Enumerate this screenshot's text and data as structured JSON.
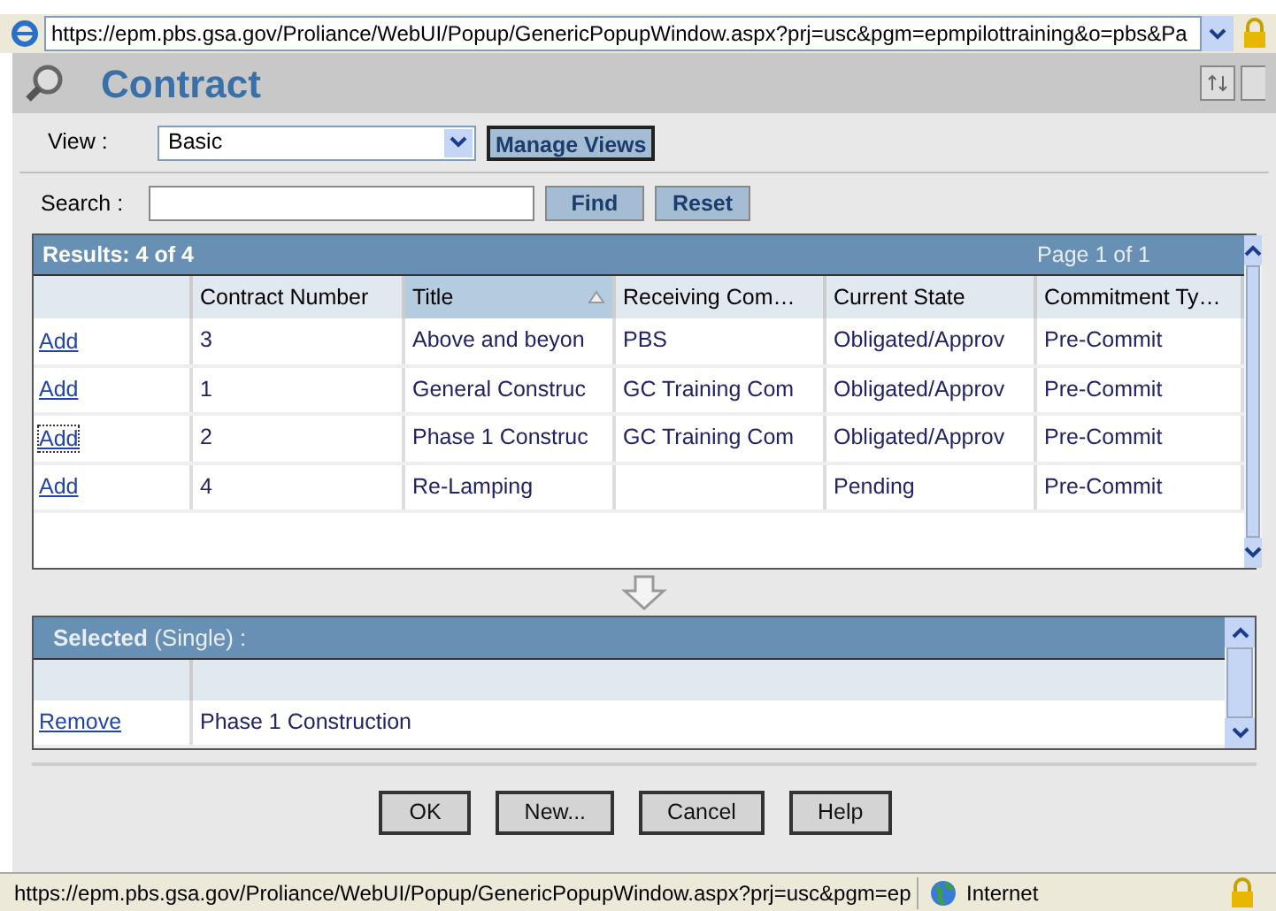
{
  "address_bar": {
    "url": "https://epm.pbs.gsa.gov/Proliance/WebUI/Popup/GenericPopupWindow.aspx?prj=usc&pgm=epmpilottraining&o=pbs&Pa"
  },
  "header": {
    "title": "Contract"
  },
  "view": {
    "label": "View :",
    "value": "Basic",
    "manage_button": "Manage Views"
  },
  "search": {
    "label": "Search :",
    "find_button": "Find",
    "reset_button": "Reset"
  },
  "results": {
    "title": "Results: 4 of 4",
    "page": "Page 1 of 1",
    "columns": [
      {
        "label": "Contract Number",
        "sorted": false
      },
      {
        "label": "Title",
        "sorted": true
      },
      {
        "label": "Receiving Com…",
        "sorted": false
      },
      {
        "label": "Current State",
        "sorted": false
      },
      {
        "label": "Commitment Ty…",
        "sorted": false
      }
    ],
    "rows": [
      {
        "action": "Add",
        "focused": false,
        "cells": [
          "3",
          "Above and beyon",
          "PBS",
          "Obligated/Approv",
          "Pre-Commit"
        ]
      },
      {
        "action": "Add",
        "focused": false,
        "cells": [
          "1",
          "General Construc",
          "GC Training Com",
          "Obligated/Approv",
          "Pre-Commit"
        ]
      },
      {
        "action": "Add",
        "focused": true,
        "cells": [
          "2",
          "Phase 1 Construc",
          "GC Training Com",
          "Obligated/Approv",
          "Pre-Commit"
        ]
      },
      {
        "action": "Add",
        "focused": false,
        "cells": [
          "4",
          "Re-Lamping",
          "",
          "Pending",
          "Pre-Commit"
        ]
      }
    ]
  },
  "selected": {
    "title": "**Selected** (Single) :",
    "rows": [
      {
        "action": "Remove",
        "cells": [
          "Phase 1 Construction"
        ]
      }
    ]
  },
  "buttons": [
    "OK",
    "New...",
    "Cancel",
    "Help"
  ],
  "status_bar": {
    "url": "https://epm.pbs.gsa.gov/Proliance/WebUI/Popup/GenericPopupWindow.aspx?prj=usc&pgm=ep",
    "zone": "Internet"
  }
}
